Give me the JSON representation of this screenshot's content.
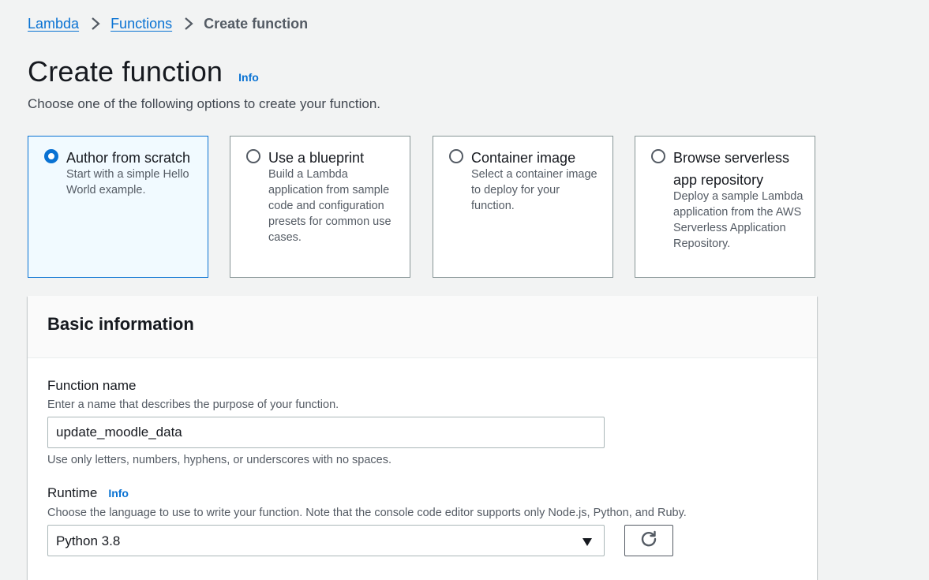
{
  "breadcrumb": {
    "items": [
      {
        "label": "Lambda"
      },
      {
        "label": "Functions"
      },
      {
        "label": "Create function"
      }
    ]
  },
  "header": {
    "title": "Create function",
    "info": "Info",
    "description": "Choose one of the following options to create your function."
  },
  "options": [
    {
      "label": "Author from scratch",
      "description": "Start with a simple Hello World example.",
      "selected": true
    },
    {
      "label": "Use a blueprint",
      "description": "Build a Lambda application from sample code and configuration presets for common use cases.",
      "selected": false
    },
    {
      "label": "Container image",
      "description": "Select a container image to deploy for your function.",
      "selected": false
    },
    {
      "label": "Browse serverless app repository",
      "description": "Deploy a sample Lambda application from the AWS Serverless Application Repository.",
      "selected": false
    }
  ],
  "basic_info": {
    "title": "Basic information",
    "function_name": {
      "label": "Function name",
      "description": "Enter a name that describes the purpose of your function.",
      "value": "update_moodle_data",
      "hint": "Use only letters, numbers, hyphens, or underscores with no spaces."
    },
    "runtime": {
      "label": "Runtime",
      "info": "Info",
      "description": "Choose the language to use to write your function. Note that the console code editor supports only Node.js, Python, and Ruby.",
      "value": "Python 3.8"
    }
  },
  "colors": {
    "accent": "#0972d3",
    "selected_bg": "#f1faff",
    "page_bg": "#f2f3f3"
  }
}
